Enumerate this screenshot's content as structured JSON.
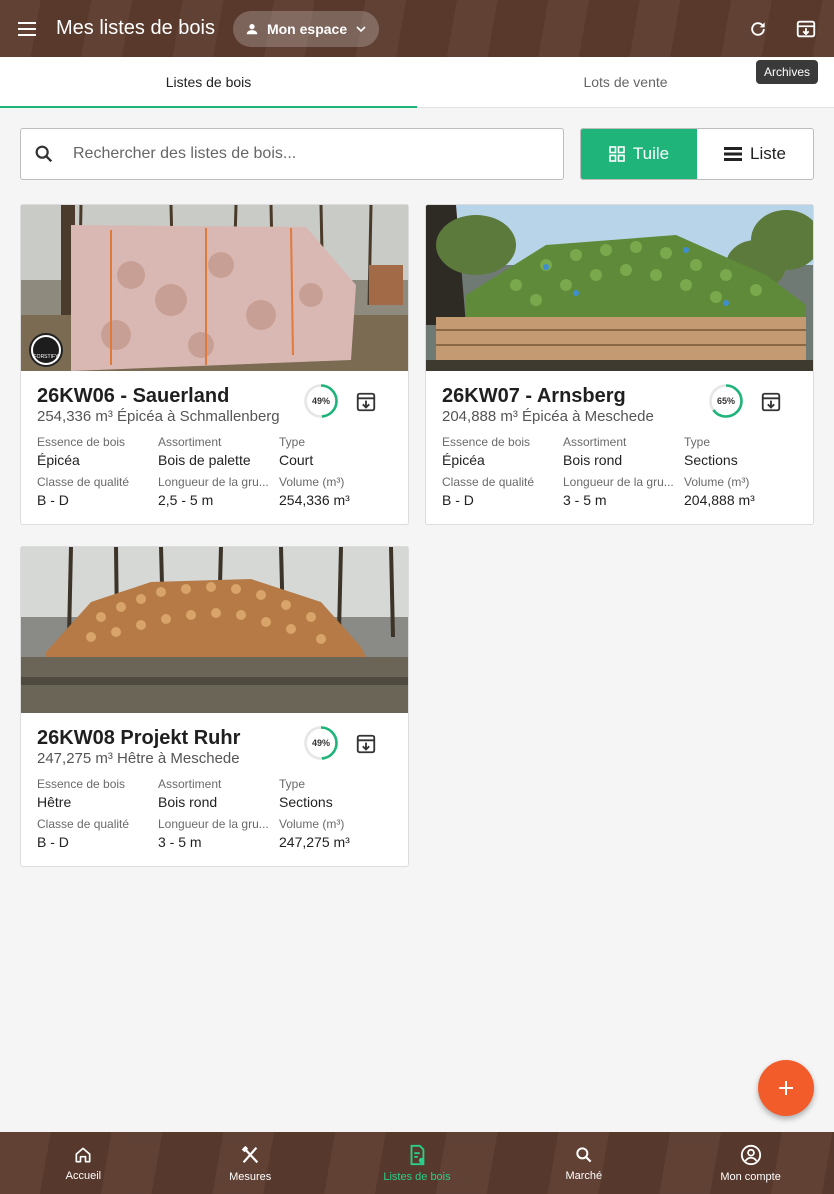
{
  "header": {
    "title": "Mes listes de bois",
    "space_label": "Mon espace",
    "tooltip": "Archives"
  },
  "tabs": [
    {
      "label": "Listes de bois",
      "active": true
    },
    {
      "label": "Lots de vente",
      "active": false
    }
  ],
  "search": {
    "placeholder": "Rechercher des listes de bois..."
  },
  "view_toggle": {
    "tile_label": "Tuile",
    "list_label": "Liste",
    "selected": "Tuile"
  },
  "cards": [
    {
      "title": "26KW06 - Sauerland",
      "subtitle": "254,336 m³ Épicéa à Schmallenberg",
      "progress": 49,
      "progress_label": "49%",
      "badge": "FORSTIFY",
      "fields": {
        "essence_label": "Essence de bois",
        "essence": "Épicéa",
        "assortiment_label": "Assortiment",
        "assortiment": "Bois de palette",
        "type_label": "Type",
        "type": "Court",
        "qualite_label": "Classe de qualité",
        "qualite": "B - D",
        "longueur_label": "Longueur de la gru...",
        "longueur": "2,5 - 5 m",
        "volume_label": "Volume (m³)",
        "volume": "254,336 m³"
      }
    },
    {
      "title": "26KW07 - Arnsberg",
      "subtitle": "204,888 m³ Épicéa à Meschede",
      "progress": 65,
      "progress_label": "65%",
      "fields": {
        "essence_label": "Essence de bois",
        "essence": "Épicéa",
        "assortiment_label": "Assortiment",
        "assortiment": "Bois rond",
        "type_label": "Type",
        "type": "Sections",
        "qualite_label": "Classe de qualité",
        "qualite": "B - D",
        "longueur_label": "Longueur de la gru...",
        "longueur": "3 - 5 m",
        "volume_label": "Volume (m³)",
        "volume": "204,888 m³"
      }
    },
    {
      "title": "26KW08 Projekt Ruhr",
      "subtitle": "247,275 m³ Hêtre à Meschede",
      "progress": 49,
      "progress_label": "49%",
      "fields": {
        "essence_label": "Essence de bois",
        "essence": "Hêtre",
        "assortiment_label": "Assortiment",
        "assortiment": "Bois rond",
        "type_label": "Type",
        "type": "Sections",
        "qualite_label": "Classe de qualité",
        "qualite": "B - D",
        "longueur_label": "Longueur de la gru...",
        "longueur": "3 - 5 m",
        "volume_label": "Volume (m³)",
        "volume": "247,275 m³"
      }
    }
  ],
  "bottom_nav": [
    {
      "label": "Accueil",
      "icon": "home-icon"
    },
    {
      "label": "Mesures",
      "icon": "measure-icon"
    },
    {
      "label": "Listes de bois",
      "icon": "wood-list-icon",
      "active": true
    },
    {
      "label": "Marché",
      "icon": "search-icon"
    },
    {
      "label": "Mon compte",
      "icon": "account-icon"
    }
  ],
  "colors": {
    "brand_brown": "#5b3b2e",
    "accent_green": "#1fb57a",
    "fab_orange": "#f25b2a"
  }
}
